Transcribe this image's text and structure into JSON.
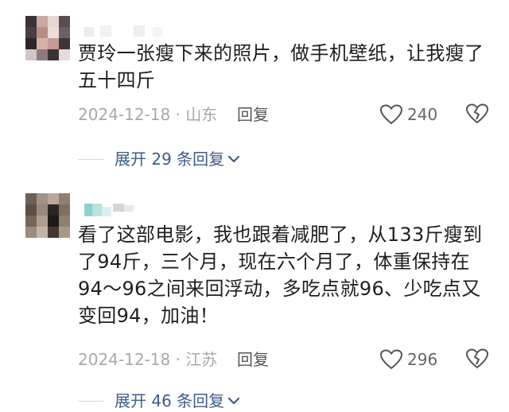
{
  "comments": [
    {
      "text": "贾玲一张瘦下来的照片，做手机壁纸，让我瘦了五十四斤",
      "date": "2024-12-18 · 山东",
      "reply_label": "回复",
      "likes": "240",
      "expand_label": "展开 29 条回复"
    },
    {
      "text": "看了这部电影，我也跟着减肥了，从133斤瘦到了94斤，三个月，现在六个月了，体重保持在94～96之间来回浮动，多吃点就96、少吃点又变回94，加油！",
      "date": "2024-12-18 · 江苏",
      "reply_label": "回复",
      "likes": "296",
      "expand_label": "展开 46 条回复"
    }
  ],
  "icons": {
    "like": "heart-outline-icon",
    "dislike": "broken-heart-icon",
    "expand": "chevron-down-icon"
  },
  "colors": {
    "link": "#3e5c86",
    "meta": "#a8a8a8"
  }
}
